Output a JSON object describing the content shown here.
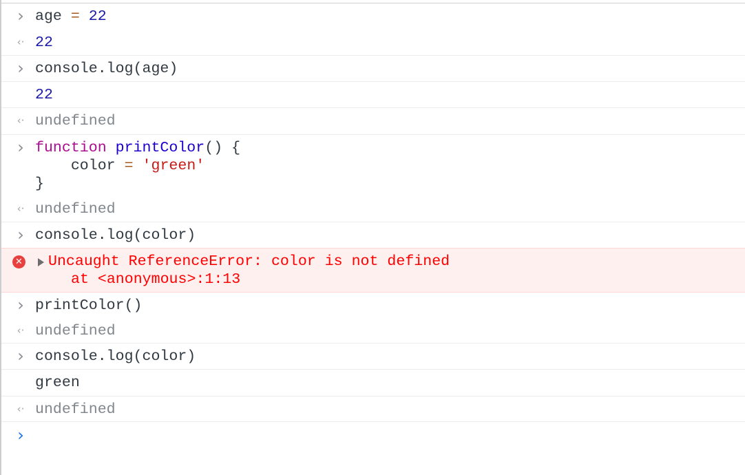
{
  "entries": [
    {
      "kind": "input",
      "h": 38,
      "sep": false,
      "lines": [
        [
          [
            "age ",
            "plain"
          ],
          [
            "=",
            "op"
          ],
          [
            " ",
            "plain"
          ],
          [
            "22",
            "num"
          ]
        ]
      ]
    },
    {
      "kind": "result",
      "h": 38,
      "sep": true,
      "lines": [
        [
          [
            "22",
            "num"
          ]
        ]
      ]
    },
    {
      "kind": "input",
      "h": 38,
      "sep": true,
      "lines": [
        [
          [
            "console.log(age)",
            "plain"
          ]
        ]
      ]
    },
    {
      "kind": "log",
      "h": 38,
      "sep": true,
      "lines": [
        [
          [
            "22",
            "num"
          ]
        ]
      ]
    },
    {
      "kind": "result",
      "h": 39,
      "sep": true,
      "lines": [
        [
          [
            "undefined",
            "undef"
          ]
        ]
      ]
    },
    {
      "kind": "input",
      "h": 89,
      "sep": false,
      "lines": [
        [
          [
            "function",
            "kw"
          ],
          [
            " ",
            "plain"
          ],
          [
            "printColor",
            "def"
          ],
          [
            "() {",
            "plain"
          ]
        ],
        [
          [
            "    color ",
            "plain"
          ],
          [
            "=",
            "op"
          ],
          [
            " ",
            "plain"
          ],
          [
            "'green'",
            "str"
          ]
        ],
        [
          [
            "}",
            "plain"
          ]
        ]
      ]
    },
    {
      "kind": "result",
      "h": 38,
      "sep": true,
      "lines": [
        [
          [
            "undefined",
            "undef"
          ]
        ]
      ]
    },
    {
      "kind": "input",
      "h": 37,
      "sep": false,
      "lines": [
        [
          [
            "console.log(color)",
            "plain"
          ]
        ]
      ]
    },
    {
      "kind": "error",
      "h": 65,
      "message": "Uncaught ReferenceError: color is not defined",
      "stack": "at <anonymous>:1:13"
    },
    {
      "kind": "input",
      "h": 37,
      "sep": false,
      "lines": [
        [
          [
            "printColor()",
            "plain"
          ]
        ]
      ]
    },
    {
      "kind": "result",
      "h": 37,
      "sep": true,
      "lines": [
        [
          [
            "undefined",
            "undef"
          ]
        ]
      ]
    },
    {
      "kind": "input",
      "h": 38,
      "sep": true,
      "lines": [
        [
          [
            "console.log(color)",
            "plain"
          ]
        ]
      ]
    },
    {
      "kind": "log",
      "h": 39,
      "sep": true,
      "lines": [
        [
          [
            "green",
            "plain"
          ]
        ]
      ]
    },
    {
      "kind": "result",
      "h": 37,
      "sep": true,
      "lines": [
        [
          [
            "undefined",
            "undef"
          ]
        ]
      ]
    }
  ],
  "icons": {
    "input": "chevron-right-icon",
    "result": "return-arrow-icon",
    "error": "error-icon",
    "prompt": "prompt-icon"
  },
  "glyphs": {
    "input": "›",
    "result": "‹·",
    "error": "✕",
    "prompt": "›"
  },
  "prompt": {
    "value": ""
  }
}
